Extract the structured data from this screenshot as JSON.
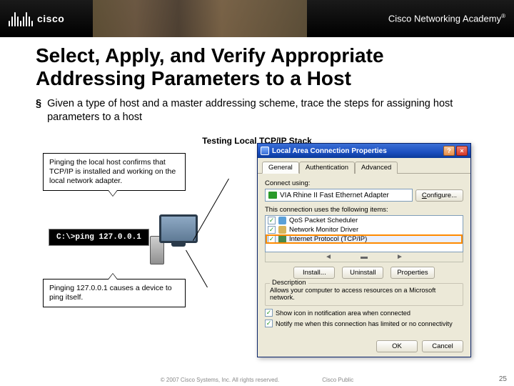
{
  "header": {
    "brand": "cisco",
    "academy": "Cisco Networking Academy"
  },
  "slide": {
    "title": "Select, Apply, and Verify Appropriate Addressing Parameters to a Host",
    "bullet1": "Given a type of host and a master addressing scheme, trace the steps for assigning host parameters to a host"
  },
  "diagram": {
    "title": "Testing Local TCP/IP Stack",
    "callout_top": "Pinging the local host confirms that TCP/IP is installed and working on the local network adapter.",
    "terminal": "C:\\>ping 127.0.0.1",
    "callout_bottom": "Pinging 127.0.0.1 causes a device to ping itself."
  },
  "dialog": {
    "title": "Local Area Connection Properties",
    "tabs": {
      "general": "General",
      "auth": "Authentication",
      "adv": "Advanced"
    },
    "connect_label": "Connect using:",
    "adapter": "VIA Rhine II Fast Ethernet Adapter",
    "configure_btn": "Configure...",
    "items_label": "This connection uses the following items:",
    "items": [
      {
        "label": "QoS Packet Scheduler"
      },
      {
        "label": "Network Monitor Driver"
      },
      {
        "label": "Internet Protocol (TCP/IP)"
      }
    ],
    "install_btn": "Install...",
    "uninstall_btn": "Uninstall",
    "properties_btn": "Properties",
    "desc_title": "Description",
    "desc_text": "Allows your computer to access resources on a Microsoft network.",
    "show_icon": "Show icon in notification area when connected",
    "notify": "Notify me when this connection has limited or no connectivity",
    "ok": "OK",
    "cancel": "Cancel"
  },
  "footer": {
    "copyright": "© 2007 Cisco Systems, Inc. All rights reserved.",
    "classification": "Cisco Public",
    "page": "25"
  }
}
